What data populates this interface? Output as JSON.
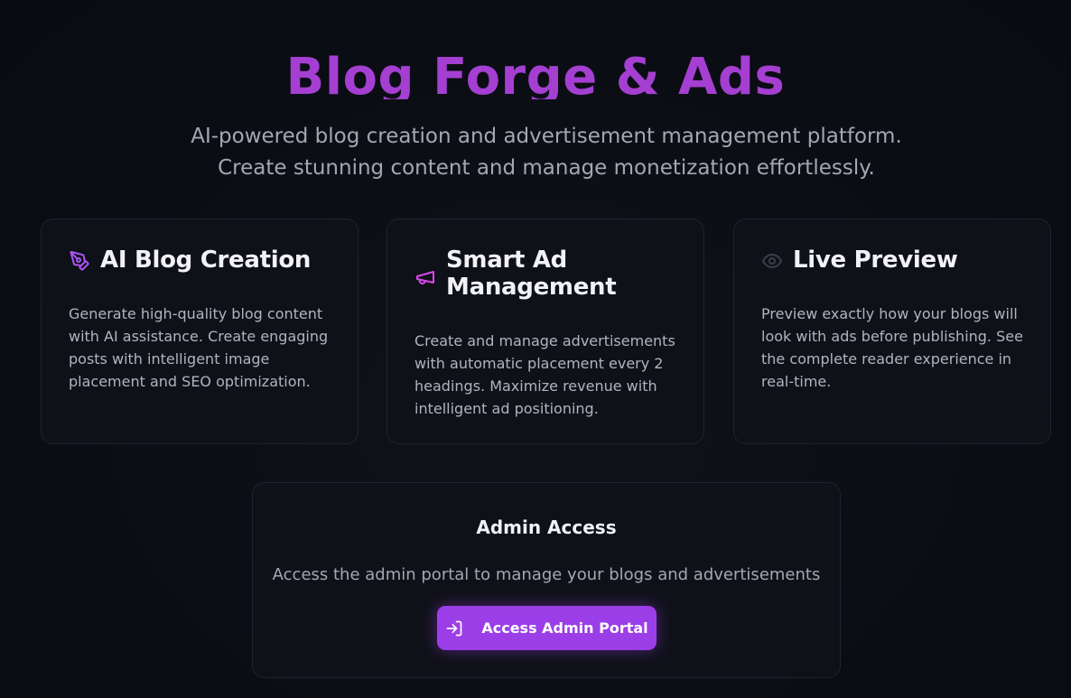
{
  "hero": {
    "title": "Blog Forge & Ads",
    "subtitle": "AI-powered blog creation and advertisement management platform. Create stunning content and manage monetization effortlessly."
  },
  "features": [
    {
      "icon": "pen-tool-icon",
      "title": "AI Blog Creation",
      "description": "Generate high-quality blog content with AI assistance. Create engaging posts with intelligent image placement and SEO optimization."
    },
    {
      "icon": "megaphone-icon",
      "title": "Smart Ad Management",
      "description": "Create and manage advertisements with automatic placement every 2 headings. Maximize revenue with intelligent ad positioning."
    },
    {
      "icon": "eye-icon",
      "title": "Live Preview",
      "description": "Preview exactly how your blogs will look with ads before publishing. See the complete reader experience in real-time."
    }
  ],
  "admin": {
    "title": "Admin Access",
    "description": "Access the admin portal to manage your blogs and advertisements",
    "button_icon": "log-in-icon",
    "button_label": "Access Admin Portal"
  },
  "colors": {
    "background": "#0b0d14",
    "accent": "#9b3ee8",
    "title": "#a43fd1",
    "pen_icon": "#a855f7",
    "megaphone_icon": "#d946ef",
    "eye_icon": "#3a3f4c"
  }
}
